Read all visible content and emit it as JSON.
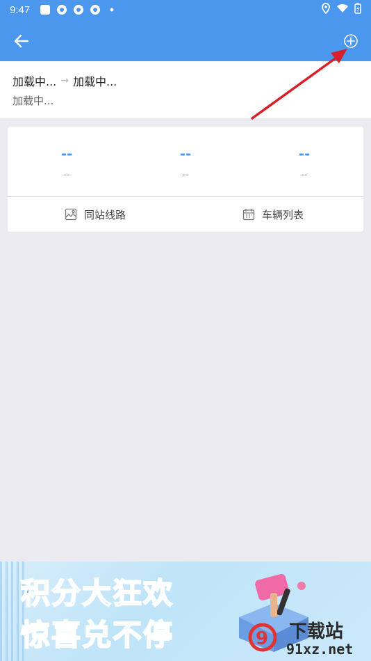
{
  "status_bar": {
    "time": "9:47"
  },
  "route": {
    "from": "加载中...",
    "to": "加载中...",
    "subtitle": "加载中..."
  },
  "stats": [
    {
      "value": "--",
      "label": "--"
    },
    {
      "value": "--",
      "label": "--"
    },
    {
      "value": "--",
      "label": "--"
    }
  ],
  "actions": {
    "same_station": "同站线路",
    "vehicle_list": "车辆列表"
  },
  "banner": {
    "line1": "积分大狂欢",
    "line2": "惊喜兑不停"
  },
  "watermark": {
    "brand": "下载站",
    "domain": "91xz.net"
  },
  "colors": {
    "accent": "#4b97ee",
    "annotation": "#d8202a"
  }
}
